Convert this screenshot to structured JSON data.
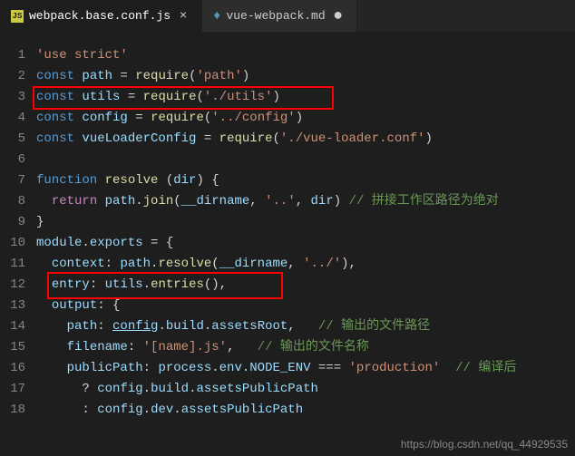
{
  "tabs": [
    {
      "label": "webpack.base.conf.js",
      "icon": "JS",
      "active": true,
      "modified": false
    },
    {
      "label": "vue-webpack.md",
      "icon": "md",
      "active": false,
      "modified": true
    }
  ],
  "lineNumbers": [
    "1",
    "2",
    "3",
    "4",
    "5",
    "6",
    "7",
    "8",
    "9",
    "10",
    "11",
    "12",
    "13",
    "14",
    "15",
    "16",
    "17",
    "18"
  ],
  "code": {
    "l1_use_strict": "'use strict'",
    "l2_const": "const",
    "l2_path": "path",
    "l2_eq": " = ",
    "l2_require": "require",
    "l2_open": "(",
    "l2_str": "'path'",
    "l2_close": ")",
    "l3_const": "const",
    "l3_utils": "utils",
    "l3_eq": " = ",
    "l3_require": "require",
    "l3_open": "(",
    "l3_str": "'./utils'",
    "l3_close": ")",
    "l4_const": "const",
    "l4_config": "config",
    "l4_eq": " = ",
    "l4_require": "require",
    "l4_open": "(",
    "l4_str": "'../config'",
    "l4_close": ")",
    "l5_const": "const",
    "l5_vlc": "vueLoaderConfig",
    "l5_eq": " = ",
    "l5_require": "require",
    "l5_open": "(",
    "l5_str": "'./vue-loader.conf'",
    "l5_close": ")",
    "l7_func": "function",
    "l7_name": "resolve",
    "l7_sp": " ",
    "l7_open": "(",
    "l7_dir": "dir",
    "l7_close": ") {",
    "l8_ret": "return",
    "l8_path": "path",
    "l8_dot": ".",
    "l8_join": "join",
    "l8_open": "(",
    "l8_dirname": "__dirname",
    "l8_c1": ", ",
    "l8_dd": "'..'",
    "l8_c2": ", ",
    "l8_dir": "dir",
    "l8_close": ") ",
    "l8_cmt": "// 拼接工作区路径为绝对",
    "l9_close": "}",
    "l10_mod": "module",
    "l10_dot": ".",
    "l10_exp": "exports",
    "l10_eq": " = {",
    "l11_ctx": "context",
    "l11_colon": ": ",
    "l11_path": "path",
    "l11_dot": ".",
    "l11_resolve": "resolve",
    "l11_open": "(",
    "l11_dirname": "__dirname",
    "l11_c": ", ",
    "l11_str": "'../'",
    "l11_close": "),",
    "l12_entry": "entry",
    "l12_colon": ": ",
    "l12_utils": "utils",
    "l12_dot": ".",
    "l12_entries": "entries",
    "l12_open": "(",
    "l12_close": "),",
    "l13_output": "output",
    "l13_colon": ": {",
    "l14_path": "path",
    "l14_colon": ": ",
    "l14_config": "config",
    "l14_dot1": ".",
    "l14_build": "build",
    "l14_dot2": ".",
    "l14_ar": "assetsRoot",
    "l14_c": ",   ",
    "l14_cmt": "// 输出的文件路径",
    "l15_fn": "filename",
    "l15_colon": ": ",
    "l15_str": "'[name].js'",
    "l15_c": ",   ",
    "l15_cmt": "// 输出的文件名称",
    "l16_pp": "publicPath",
    "l16_colon": ": ",
    "l16_proc": "process",
    "l16_d1": ".",
    "l16_env": "env",
    "l16_d2": ".",
    "l16_node": "NODE_ENV",
    "l16_eq": " === ",
    "l16_str": "'production'",
    "l16_sp": "  ",
    "l16_cmt": "// 编译后",
    "l17_q": "? ",
    "l17_config": "config",
    "l17_d1": ".",
    "l17_build": "build",
    "l17_d2": ".",
    "l17_app": "assetsPublicPath",
    "l18_q": ": ",
    "l18_config": "config",
    "l18_d1": ".",
    "l18_dev": "dev",
    "l18_d2": ".",
    "l18_app": "assetsPublicPath"
  },
  "watermark": "https://blog.csdn.net/qq_44929535"
}
